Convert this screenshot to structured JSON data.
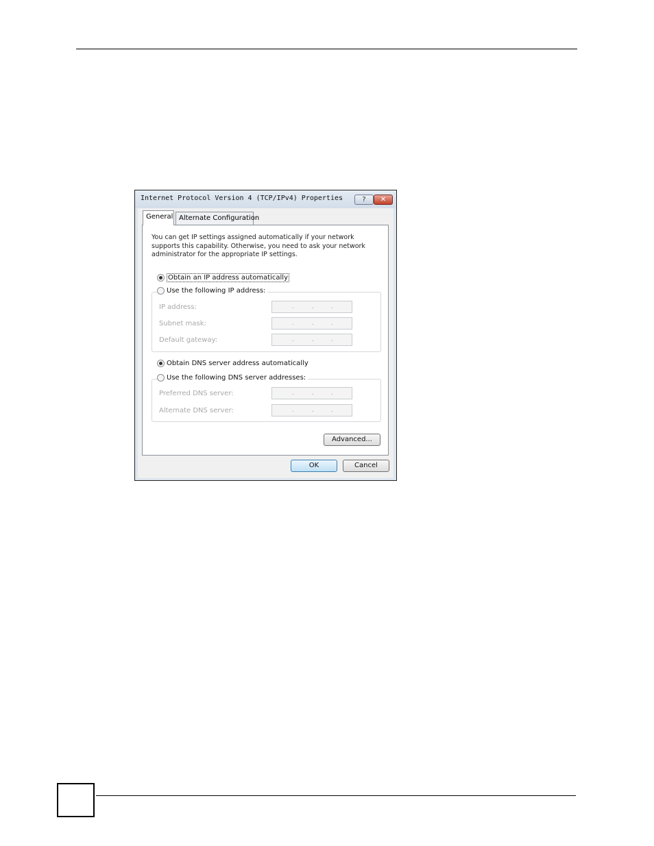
{
  "dialog": {
    "title": "Internet Protocol Version 4 (TCP/IPv4) Properties",
    "help_label": "?",
    "close_label": "✕"
  },
  "tabs": [
    {
      "label": "General",
      "selected": true
    },
    {
      "label": "Alternate Configuration",
      "selected": false
    }
  ],
  "intro_text": "You can get IP settings assigned automatically if your network supports this capability. Otherwise, you need to ask your network administrator for the appropriate IP settings.",
  "ip_options": {
    "auto_label": "Obtain an IP address automatically",
    "manual_label": "Use the following IP address:",
    "selected": "auto"
  },
  "ip_fields": [
    {
      "label": "IP address:",
      "value": ""
    },
    {
      "label": "Subnet mask:",
      "value": ""
    },
    {
      "label": "Default gateway:",
      "value": ""
    }
  ],
  "dns_options": {
    "auto_label": "Obtain DNS server address automatically",
    "manual_label": "Use the following DNS server addresses:",
    "selected": "auto"
  },
  "dns_fields": [
    {
      "label": "Preferred DNS server:",
      "value": ""
    },
    {
      "label": "Alternate DNS server:",
      "value": ""
    }
  ],
  "buttons": {
    "advanced": "Advanced...",
    "ok": "OK",
    "cancel": "Cancel"
  },
  "ip_separator": "."
}
